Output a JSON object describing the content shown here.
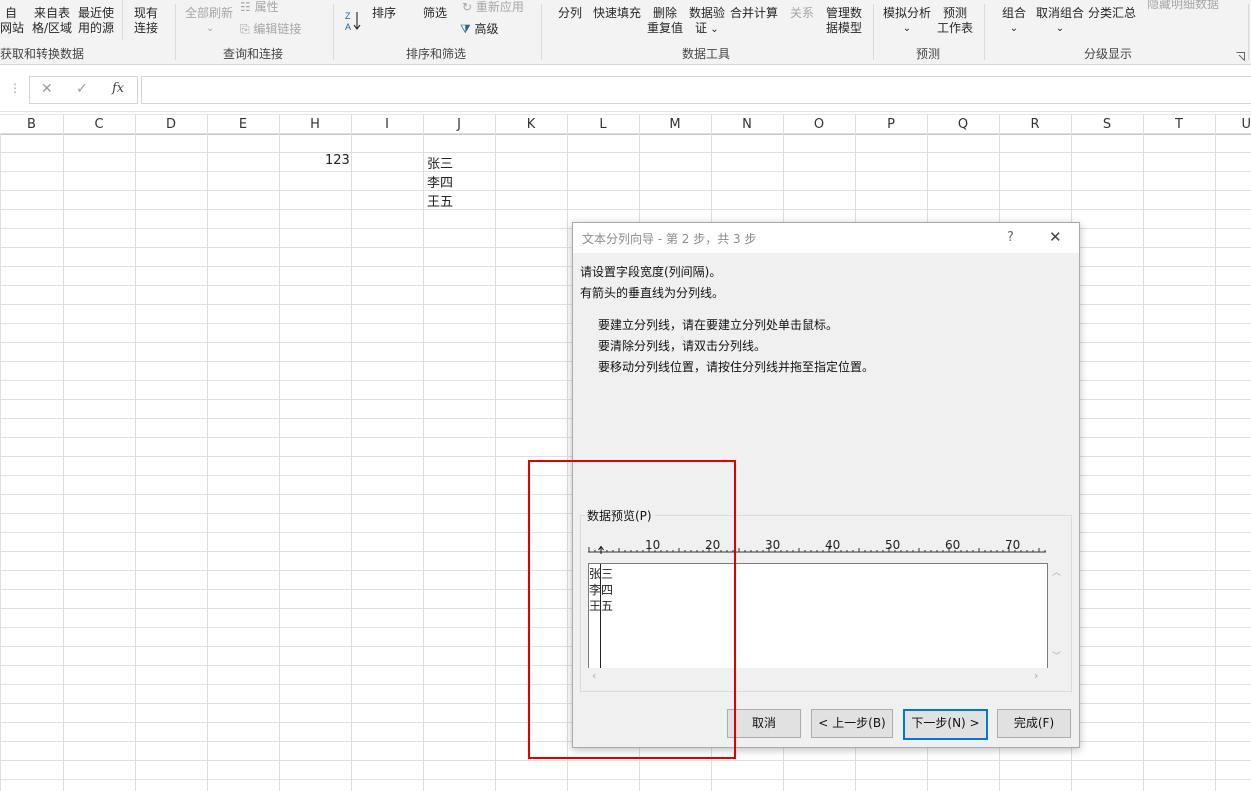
{
  "ribbon": {
    "get_transform": {
      "btn1": [
        "自",
        "网站"
      ],
      "btn2": [
        "来自表",
        "格/区域"
      ],
      "btn3": [
        "最近使",
        "用的源"
      ],
      "btn4": [
        "现有",
        "连接"
      ],
      "group_label": "获取和转换数据"
    },
    "queries": {
      "refresh_all": "全部刷新",
      "properties": "属性",
      "edit_links": "编辑链接",
      "group_label": "查询和连接"
    },
    "sort_filter": {
      "sort": "排序",
      "filter": "筛选",
      "reapply": "重新应用",
      "advanced": "高级",
      "group_label": "排序和筛选"
    },
    "data_tools": {
      "split": "分列",
      "flash_fill": [
        "快速填充"
      ],
      "remove_dup": [
        "删除",
        "重复值"
      ],
      "validation": [
        "数据验",
        "证"
      ],
      "consolidate": "合并计算",
      "relations": "关系",
      "manage_model": [
        "管理数",
        "据模型"
      ],
      "group_label": "数据工具"
    },
    "forecast": {
      "what_if": "模拟分析",
      "forecast_sheet": [
        "预测",
        "工作表"
      ],
      "group_label": "预测"
    },
    "outline": {
      "group": "组合",
      "ungroup": "取消组合",
      "subtotal": "分类汇总",
      "hide_detail": "隐藏明细数据",
      "group_label": "分级显示"
    }
  },
  "formula_bar": {
    "cancel_glyph": "✕",
    "enter_glyph": "✓",
    "fx_glyph": "fx",
    "value": ""
  },
  "columns": [
    "B",
    "C",
    "D",
    "E",
    "H",
    "I",
    "J",
    "K",
    "L",
    "M",
    "N",
    "O",
    "P",
    "Q",
    "R",
    "S",
    "T",
    "U"
  ],
  "cells": {
    "h1": "123",
    "j1": "张三",
    "j2": "李四",
    "j3": "王五"
  },
  "dialog": {
    "title": "文本分列向导 - 第 2 步，共 3 步",
    "help": "?",
    "close": "✕",
    "line1": "请设置字段宽度(列间隔)。",
    "line2": "有箭头的垂直线为分列线。",
    "hint1": "要建立分列线，请在要建立分列处单击鼠标。",
    "hint2": "要清除分列线，请双击分列线。",
    "hint3": "要移动分列线位置，请按住分列线并拖至指定位置。",
    "preview_label": "数据预览(P)",
    "ruler_ticks": [
      "10",
      "20",
      "30",
      "40",
      "50",
      "60",
      "70"
    ],
    "preview_rows": [
      "张三",
      "李四",
      "王五"
    ],
    "buttons": {
      "cancel": "取消",
      "back": "< 上一步(B)",
      "next": "下一步(N) >",
      "finish": "完成(F)"
    }
  },
  "colors": {
    "highlight_box": "#e00000",
    "primary_border": "#0078d7"
  }
}
